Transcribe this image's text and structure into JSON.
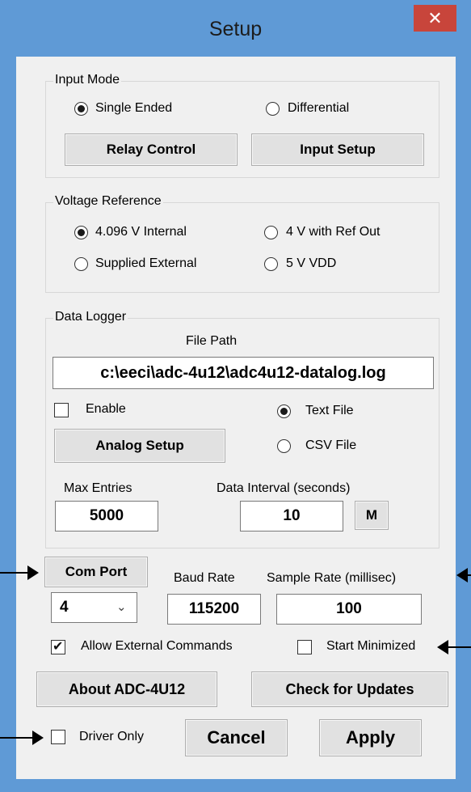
{
  "window": {
    "title": "Setup",
    "close_glyph": "✕"
  },
  "input_mode": {
    "legend": "Input Mode",
    "options": [
      "Single Ended",
      "Differential"
    ],
    "selected": "Single Ended",
    "relay_button": "Relay Control",
    "input_setup_button": "Input Setup"
  },
  "voltage_reference": {
    "legend": "Voltage Reference",
    "options": [
      "4.096 V Internal",
      "4 V with Ref Out",
      "Supplied External",
      "5 V VDD"
    ],
    "selected": "4.096 V Internal"
  },
  "data_logger": {
    "legend": "Data Logger",
    "file_path_label": "File Path",
    "file_path_value": "c:\\eeci\\adc-4u12\\adc4u12-datalog.log",
    "enable_label": "Enable",
    "enable_checked": false,
    "text_file_label": "Text File",
    "csv_file_label": "CSV File",
    "file_type_selected": "Text File",
    "analog_setup_button": "Analog Setup",
    "max_entries_label": "Max Entries",
    "max_entries_value": "5000",
    "data_interval_label": "Data Interval (seconds)",
    "data_interval_value": "10",
    "m_button": "M"
  },
  "com": {
    "com_port_button": "Com Port",
    "com_port_value": "4",
    "baud_rate_label": "Baud Rate",
    "baud_rate_value": "115200",
    "sample_rate_label": "Sample Rate (millisec)",
    "sample_rate_value": "100"
  },
  "options": {
    "allow_external_label": "Allow External Commands",
    "allow_external_checked": true,
    "start_minimized_label": "Start Minimized",
    "start_minimized_checked": false,
    "driver_only_label": "Driver Only",
    "driver_only_checked": false
  },
  "buttons": {
    "about": "About ADC-4U12",
    "check_updates": "Check for Updates",
    "cancel": "Cancel",
    "apply": "Apply"
  },
  "colors": {
    "title_bar": "#5f9ad6",
    "close": "#c8453b",
    "client": "#f0f0f0"
  }
}
